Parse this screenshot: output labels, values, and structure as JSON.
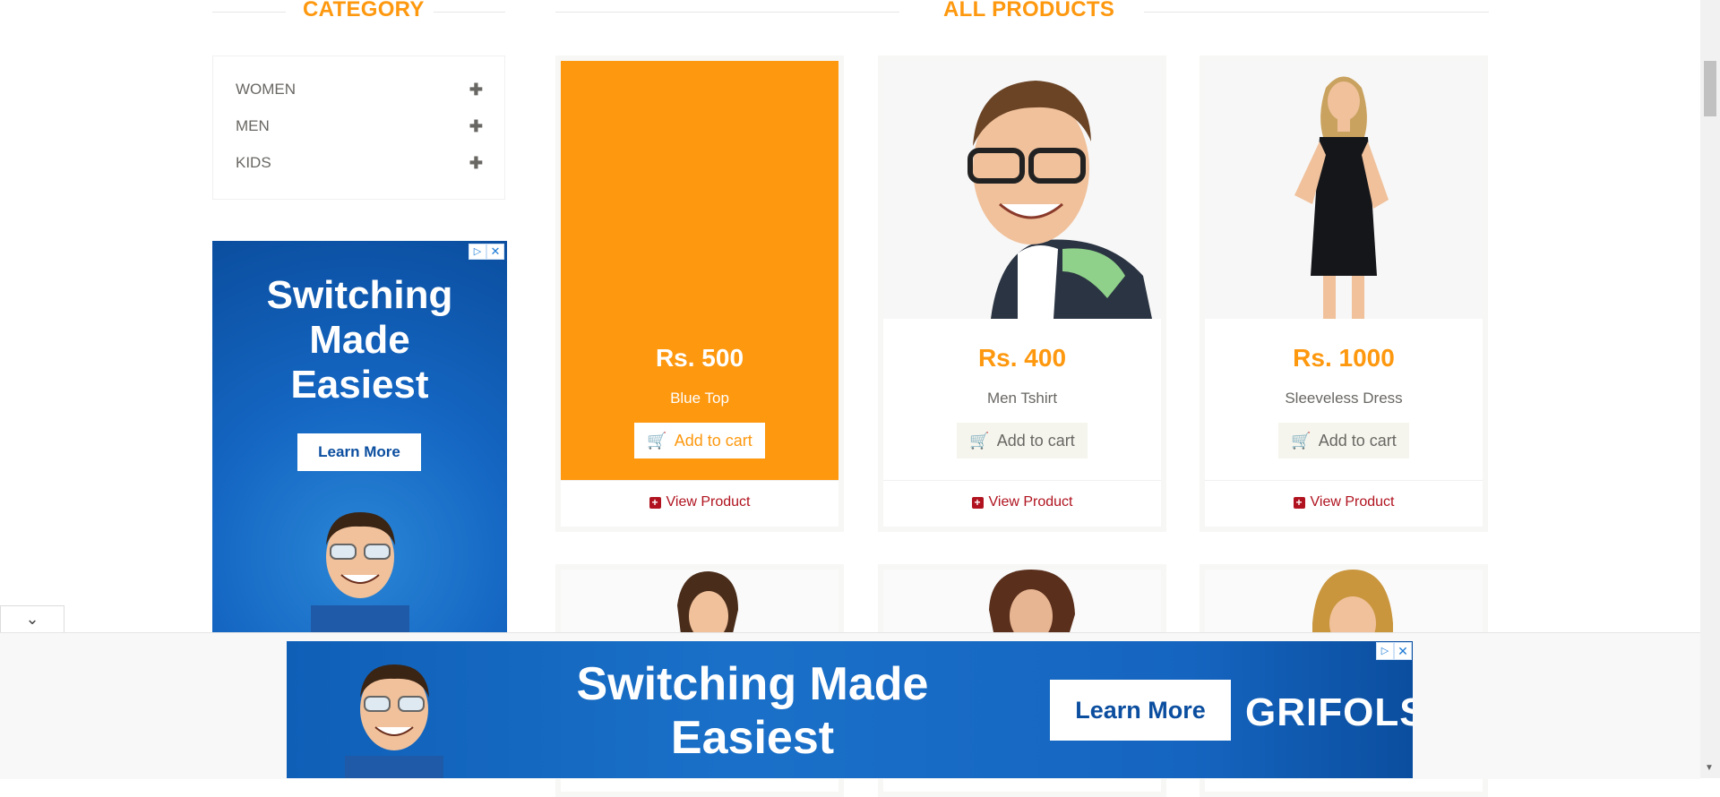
{
  "headings": {
    "category": "CATEGORY",
    "products": "ALL PRODUCTS"
  },
  "categories": [
    {
      "label": "WOMEN",
      "icon": "plus"
    },
    {
      "label": "MEN",
      "icon": "plus"
    },
    {
      "label": "KIDS",
      "icon": "plus"
    }
  ],
  "side_ad": {
    "title_lines": [
      "Switching",
      "Made",
      "Easiest"
    ],
    "button": "Learn More"
  },
  "products": [
    {
      "price": "Rs. 500",
      "name": "Blue Top",
      "cart_label": "Add to cart",
      "view_label": "View Product"
    },
    {
      "price": "Rs. 400",
      "name": "Men Tshirt",
      "cart_label": "Add to cart",
      "view_label": "View Product"
    },
    {
      "price": "Rs. 1000",
      "name": "Sleeveless Dress",
      "cart_label": "Add to cart",
      "view_label": "View Product"
    }
  ],
  "bottom_ad": {
    "title_lines": [
      "Switching Made",
      "Easiest"
    ],
    "button": "Learn More",
    "brand": "GRIFOLS"
  },
  "colors": {
    "accent": "#FE980F",
    "view_link": "#b0131f",
    "ad_blue": "#1466c2"
  }
}
